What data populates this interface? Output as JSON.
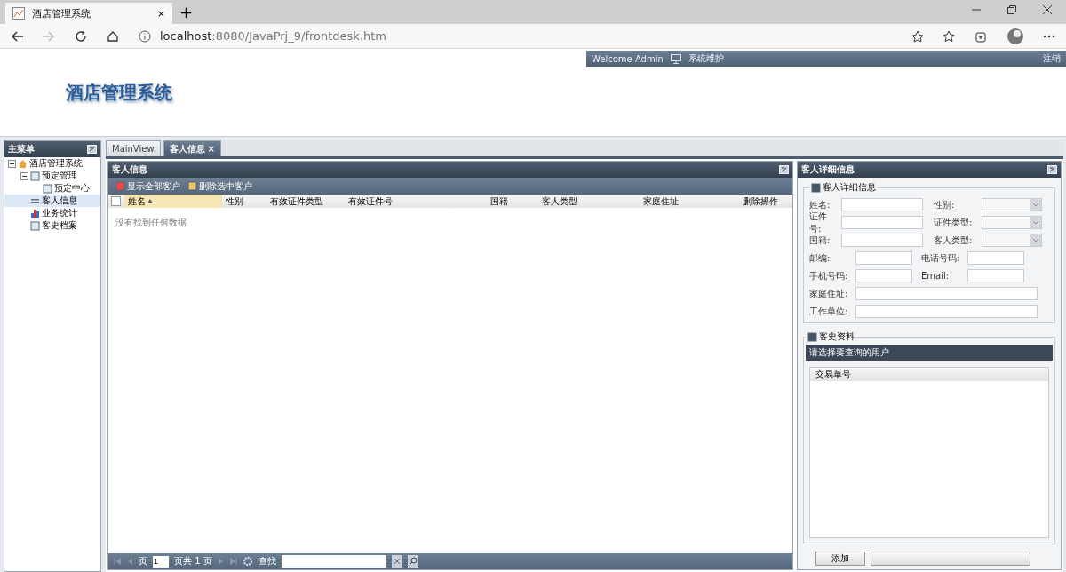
{
  "browser": {
    "tab_title": "酒店管理系统",
    "tab_close": "×",
    "new_tab": "+",
    "url_host": "localhost",
    "url_rest": ":8080/JavaPrj_9/frontdesk.htm"
  },
  "top_bar": {
    "welcome": "Welcome Admin",
    "system": "系统维护",
    "logout": "注销"
  },
  "app_title": "酒店管理系统",
  "sidebar": {
    "title": "主菜单",
    "items": [
      {
        "label": "酒店管理系统",
        "expanded": true,
        "selected": false,
        "children": [
          {
            "label": "预定管理",
            "expanded": true,
            "selected": false,
            "children": [
              {
                "label": "预定中心",
                "selected": false
              }
            ]
          },
          {
            "label": "客人信息",
            "selected": true
          },
          {
            "label": "业务统计",
            "selected": false
          },
          {
            "label": "客史档案",
            "selected": false
          }
        ]
      }
    ]
  },
  "tabs": [
    {
      "label": "MainView",
      "selected": false
    },
    {
      "label": "客人信息",
      "selected": true,
      "close": "×"
    }
  ],
  "grid": {
    "title": "客人信息",
    "toolbar": [
      {
        "label": "显示全部客户"
      },
      {
        "label": "删除选中客户"
      }
    ],
    "select_all_checked": false,
    "columns": [
      {
        "label": "姓名",
        "sorted": true
      },
      {
        "label": "性别",
        "sorted": false
      },
      {
        "label": "有效证件类型",
        "sorted": false
      },
      {
        "label": "有效证件号",
        "sorted": false
      },
      {
        "label": "国籍",
        "sorted": false
      },
      {
        "label": "客人类型",
        "sorted": false
      },
      {
        "label": "家庭住址",
        "sorted": false
      },
      {
        "label": "删除操作",
        "sorted": false
      }
    ],
    "empty": "没有找到任何数据",
    "pager": {
      "page_label": "页",
      "page": "1",
      "total": "页共 1 页",
      "search_label": "查找"
    }
  },
  "details": {
    "title": "客人详细信息",
    "fieldset": "客人详细信息",
    "rows_top": [
      [
        {
          "label": "姓名:",
          "kind": "text"
        },
        {
          "label": "性别:",
          "kind": "select"
        }
      ],
      [
        {
          "label": "证件号:",
          "kind": "text"
        },
        {
          "label": "证件类型:",
          "kind": "select"
        }
      ],
      [
        {
          "label": "国籍:",
          "kind": "text"
        },
        {
          "label": "客人类型:",
          "kind": "select"
        }
      ]
    ],
    "rows_bottom": [
      [
        {
          "label": "邮编:",
          "kind": "text"
        },
        {
          "label": "电话号码:",
          "kind": "text"
        }
      ],
      [
        {
          "label": "手机号码:",
          "kind": "text"
        },
        {
          "label": "Email:",
          "kind": "text"
        }
      ],
      [
        {
          "label": "家庭住址:",
          "kind": "wide"
        }
      ],
      [
        {
          "label": "工作单位:",
          "kind": "wide"
        }
      ]
    ],
    "history": {
      "legend": "客史资料",
      "header": "请选择要查询的用户",
      "column": "交易单号"
    },
    "buttons": [
      "添加"
    ]
  }
}
